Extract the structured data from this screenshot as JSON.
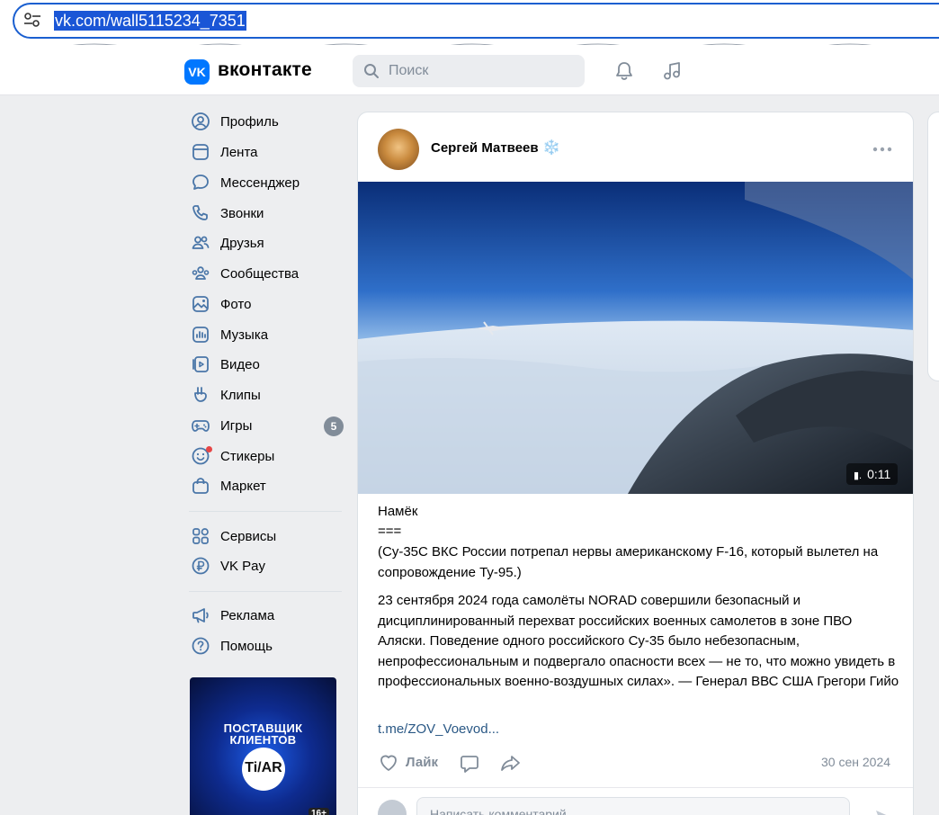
{
  "browser": {
    "url": "vk.com/wall5115234_7351"
  },
  "header": {
    "brand": "вконтакте",
    "logo_text": "VK",
    "search_placeholder": "Поиск"
  },
  "menu": {
    "items": [
      {
        "label": "Профиль",
        "icon": "user-icon"
      },
      {
        "label": "Лента",
        "icon": "feed-icon"
      },
      {
        "label": "Мессенджер",
        "icon": "message-icon"
      },
      {
        "label": "Звонки",
        "icon": "phone-icon"
      },
      {
        "label": "Друзья",
        "icon": "friends-icon"
      },
      {
        "label": "Сообщества",
        "icon": "communities-icon"
      },
      {
        "label": "Фото",
        "icon": "photo-icon"
      },
      {
        "label": "Музыка",
        "icon": "music-icon"
      },
      {
        "label": "Видео",
        "icon": "video-icon"
      },
      {
        "label": "Клипы",
        "icon": "clips-icon"
      },
      {
        "label": "Игры",
        "icon": "games-icon",
        "badge": "5"
      },
      {
        "label": "Стикеры",
        "icon": "stickers-icon"
      },
      {
        "label": "Маркет",
        "icon": "market-icon"
      }
    ],
    "secondary": [
      {
        "label": "Сервисы",
        "icon": "services-icon"
      },
      {
        "label": "VK Pay",
        "icon": "vkpay-icon"
      }
    ],
    "tertiary": [
      {
        "label": "Реклама",
        "icon": "megaphone-icon"
      },
      {
        "label": "Помощь",
        "icon": "help-icon"
      }
    ]
  },
  "ad": {
    "line1": "ПОСТАВЩИК",
    "line2": "КЛИЕНТОВ",
    "brand": "Ti/AR",
    "age": "16+"
  },
  "post": {
    "author": "Сергей Матвеев",
    "author_emoji": "❄️",
    "video_duration": "0:11",
    "title": "Намёк",
    "divider": "===",
    "paragraph1": "(Су-35С ВКС России потрепал нервы американскому F-16, который вылетел на сопровождение Ту-95.)",
    "paragraph2": "23 сентября 2024 года самолёты NORAD совершили безопасный и дисциплинированный перехват российских военных самолетов в зоне ПВО Аляски. Поведение одного российского Су-35 было небезопасным, непрофессиональным и подвергало опасности всех — не то, что можно увидеть в профессиональных военно-воздушных силах». — Генерал ВВС США Грегори Гийо",
    "link": "t.me/ZOV_Voevod...",
    "like_label": "Лайк",
    "date": "30 сен 2024",
    "comment_placeholder": "Написать комментарий"
  },
  "colors": {
    "vk_blue": "#0077ff",
    "link": "#2a5885",
    "muted": "#818c99",
    "accent_icons": "#4a76a8"
  }
}
